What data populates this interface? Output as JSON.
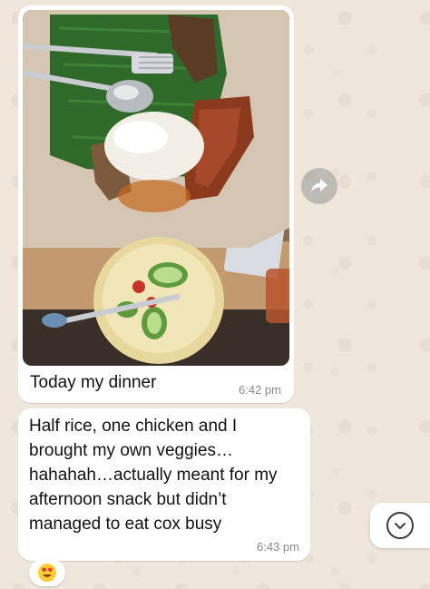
{
  "messages": [
    {
      "type": "image",
      "caption": "Today my dinner",
      "time": "6:42 pm"
    },
    {
      "type": "text",
      "lines": [
        "Half rice, one chicken and I",
        "brought my own veggies…",
        "hahahah…actually meant for my",
        "afternoon snack but didn’t",
        "managed to eat cox busy"
      ],
      "time": "6:43 pm",
      "reaction": "😍"
    }
  ],
  "icons": {
    "forward": "forward-arrow-icon",
    "scroll": "chevron-down-icon"
  },
  "colors": {
    "wallpaper": "#efe7dc",
    "bubble": "#ffffff",
    "timestamp": "#8a8a8a"
  }
}
